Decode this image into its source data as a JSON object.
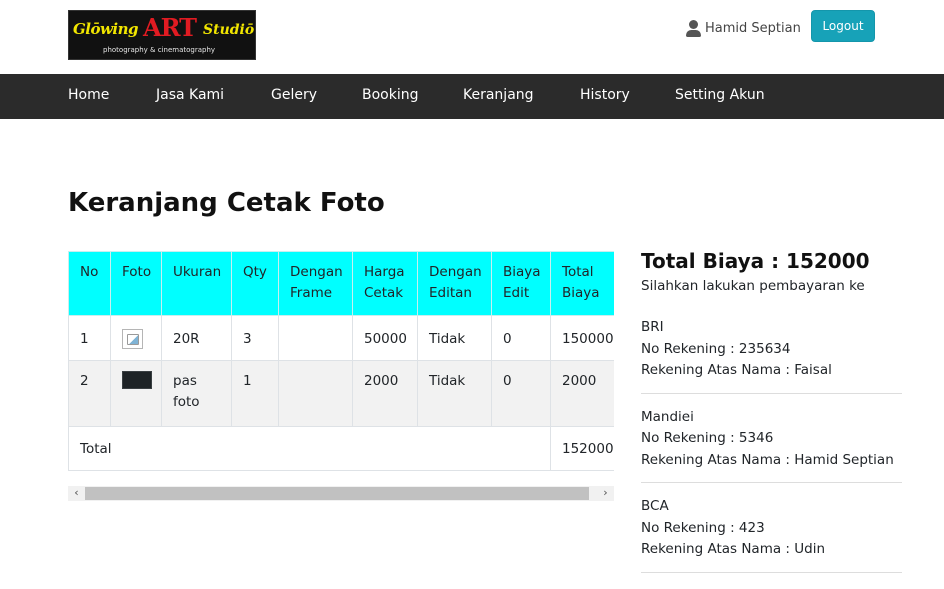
{
  "header": {
    "logo": {
      "word1": "Glōwing",
      "word2": "ART",
      "word3": "Studiō",
      "tagline": "photography & cinematography"
    },
    "user_name": "Hamid Septian",
    "logout_label": "Logout"
  },
  "nav": {
    "items": [
      {
        "label": "Home"
      },
      {
        "label": "Jasa Kami"
      },
      {
        "label": "Gelery"
      },
      {
        "label": "Booking"
      },
      {
        "label": "Keranjang"
      },
      {
        "label": "History"
      },
      {
        "label": "Setting Akun"
      }
    ]
  },
  "page_title": "Keranjang Cetak Foto",
  "cart_table": {
    "headers": [
      "No",
      "Foto",
      "Ukuran",
      "Qty",
      "Dengan Frame",
      "Harga Cetak",
      "Dengan Editan",
      "Biaya Edit",
      "Total Biaya"
    ],
    "rows": [
      {
        "no": "1",
        "foto": "broken-image-icon",
        "ukuran": "20R",
        "qty": "3",
        "frame": "",
        "harga": "50000",
        "editan": "Tidak",
        "biaya_edit": "0",
        "total": "150000"
      },
      {
        "no": "2",
        "foto": "dark-photo-thumbnail",
        "ukuran": "pas foto",
        "qty": "1",
        "frame": "",
        "harga": "2000",
        "editan": "Tidak",
        "biaya_edit": "0",
        "total": "2000"
      }
    ],
    "footer": {
      "label": "Total",
      "total": "152000"
    }
  },
  "summary": {
    "total_label": "Total Biaya : 152000",
    "note": "Silahkan lakukan pembayaran ke",
    "banks": [
      {
        "name": "BRI",
        "account": "No Rekening : 235634",
        "holder": "Rekening Atas Nama : Faisal"
      },
      {
        "name": "Mandiei",
        "account": "No Rekening : 5346",
        "holder": "Rekening Atas Nama : Hamid Septian"
      },
      {
        "name": "BCA",
        "account": "No Rekening : 423",
        "holder": "Rekening Atas Nama : Udin"
      }
    ]
  },
  "colors": {
    "nav_bg": "#2b2b2b",
    "table_header_bg": "#00ffff",
    "logout_bg": "#17a2b8",
    "striped_row_bg": "#f2f2f2"
  }
}
